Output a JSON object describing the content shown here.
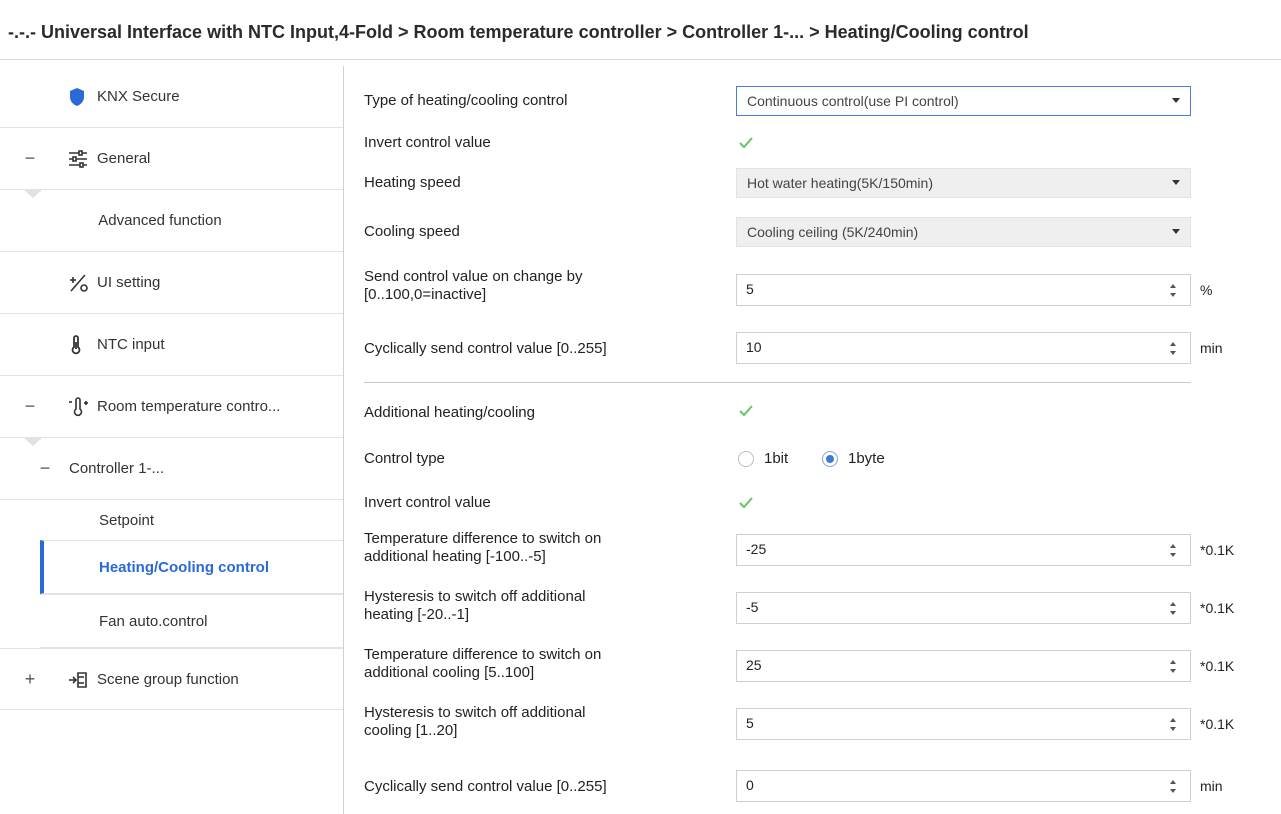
{
  "title": "-.-.- Universal Interface with NTC Input,4-Fold > Room temperature controller > Controller 1-... > Heating/Cooling control",
  "colors": {
    "accent": "#2b6ad6",
    "check": "#6ac26a",
    "shield": "#2b6ad6"
  },
  "sidebar": {
    "items": [
      {
        "label": "KNX Secure",
        "icon": "shield-icon",
        "toggle": ""
      },
      {
        "label": "General",
        "icon": "sliders-icon",
        "toggle": "−"
      },
      {
        "label": "Advanced function",
        "icon": "",
        "toggle": ""
      },
      {
        "label": "UI setting",
        "icon": "ui-setting-icon",
        "toggle": ""
      },
      {
        "label": "NTC input",
        "icon": "thermometer-icon",
        "toggle": ""
      },
      {
        "label": "Room temperature contro...",
        "icon": "room-thermometer-icon",
        "toggle": "−"
      },
      {
        "label": "Controller 1-...",
        "icon": "",
        "toggle": "−"
      },
      {
        "label": "Setpoint",
        "icon": "",
        "toggle": ""
      },
      {
        "label": "Heating/Cooling control",
        "icon": "",
        "toggle": ""
      },
      {
        "label": "Fan auto.control",
        "icon": "",
        "toggle": ""
      },
      {
        "label": "Scene group function",
        "icon": "scene-group-icon",
        "toggle": "+"
      }
    ]
  },
  "main": {
    "type_control": {
      "label": "Type of heating/cooling control",
      "value": "Continuous control(use PI control)"
    },
    "invert_1": {
      "label": "Invert control value",
      "checked": true
    },
    "heating_speed": {
      "label": "Heating speed",
      "value": "Hot water heating(5K/150min)"
    },
    "cooling_speed": {
      "label": "Cooling speed",
      "value": "Cooling ceiling (5K/240min)"
    },
    "send_on_change": {
      "label_1": "Send control value on change by",
      "label_2": "[0..100,0=inactive]",
      "value": "5",
      "unit": "%"
    },
    "cyclic_1": {
      "label": "Cyclically send control value [0..255]",
      "value": "10",
      "unit": "min"
    },
    "additional": {
      "label": "Additional heating/cooling",
      "checked": true
    },
    "control_type": {
      "label": "Control type",
      "opt_1bit": "1bit",
      "opt_1byte": "1byte",
      "selected": "1byte"
    },
    "invert_2": {
      "label": "Invert control value",
      "checked": true
    },
    "temp_diff_heat": {
      "label_1": "Temperature difference to switch on",
      "label_2": "additional heating [-100..-5]",
      "value": "-25",
      "unit": "*0.1K"
    },
    "hyst_heat": {
      "label_1": "Hysteresis to switch off additional",
      "label_2": "heating [-20..-1]",
      "value": "-5",
      "unit": "*0.1K"
    },
    "temp_diff_cool": {
      "label_1": "Temperature difference to switch on",
      "label_2": "additional cooling [5..100]",
      "value": "25",
      "unit": "*0.1K"
    },
    "hyst_cool": {
      "label_1": "Hysteresis to switch off additional",
      "label_2": "cooling [1..20]",
      "value": "5",
      "unit": "*0.1K"
    },
    "cyclic_2": {
      "label": "Cyclically send control value [0..255]",
      "value": "0",
      "unit": "min"
    }
  }
}
